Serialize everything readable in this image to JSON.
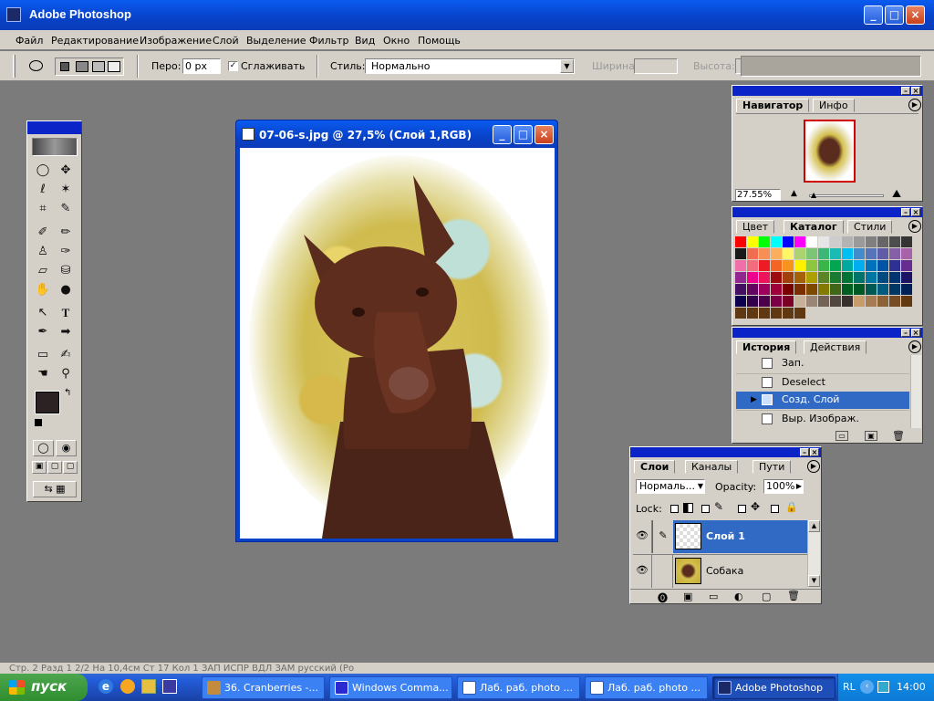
{
  "app": {
    "title": "Adobe Photoshop"
  },
  "menu": [
    "Файл",
    "Редактирование",
    "Изображение",
    "Слой",
    "Выделение",
    "Фильтр",
    "Вид",
    "Окно",
    "Помощь"
  ],
  "options": {
    "feather_label": "Перо:",
    "feather_value": "0 px",
    "antialias_label": "Сглаживать",
    "antialias_checked": true,
    "style_label": "Стиль:",
    "style_value": "Нормально",
    "width_label": "Ширина:",
    "height_label": "Высота:"
  },
  "document": {
    "title": "07-06-s.jpg @ 27,5% (Слой 1,RGB)"
  },
  "navigator": {
    "tabs": [
      "Навигатор",
      "Инфо"
    ],
    "zoom": "27.55%"
  },
  "swatches": {
    "tabs": [
      "Цвет",
      "Каталог",
      "Стили"
    ],
    "colors": [
      [
        "#ff0000",
        "#ffff00",
        "#00ff00",
        "#00ffff",
        "#0000ff",
        "#ff00ff",
        "#ffffff",
        "#e6e6e6",
        "#cdcdcd",
        "#b3b3b3",
        "#9a9a9a",
        "#808080",
        "#676767",
        "#4d4d4d",
        "#343434",
        "#1a1a1a"
      ],
      [
        "#f26c4f",
        "#f68e55",
        "#fbaf5d",
        "#fff568",
        "#acd372",
        "#7cc576",
        "#3bb878",
        "#1abbb4",
        "#00bff3",
        "#438ccb",
        "#5574b9",
        "#605ca8",
        "#855fa8",
        "#a763a8",
        "#f06ea9",
        "#f26d7d"
      ],
      [
        "#ed1c24",
        "#f26522",
        "#f7941d",
        "#fff200",
        "#8dc63f",
        "#39b54a",
        "#00a651",
        "#00a99d",
        "#00aeef",
        "#0072bc",
        "#0054a6",
        "#2e3192",
        "#662d91",
        "#92278f",
        "#ec008c",
        "#ed145b"
      ],
      [
        "#9e0b0f",
        "#a0410d",
        "#a36209",
        "#aba000",
        "#598527",
        "#197b30",
        "#007236",
        "#00746b",
        "#0076a3",
        "#004a80",
        "#003471",
        "#1b1464",
        "#440e62",
        "#630460",
        "#9e005d",
        "#9e0039"
      ],
      [
        "#790000",
        "#7b2e00",
        "#7d4900",
        "#827b00",
        "#406618",
        "#005e20",
        "#005826",
        "#005952",
        "#005b7f",
        "#003663",
        "#002157",
        "#0d004c",
        "#32004b",
        "#4b0049",
        "#7b0046",
        "#7a0026"
      ],
      [
        "#c7b299",
        "#998675",
        "#736357",
        "#534741",
        "#37302d",
        "#c69c6d",
        "#a67c52",
        "#8c6239",
        "#754c24",
        "#603913",
        "#603913",
        "#603913",
        "#603913",
        "#603913",
        "#603913",
        "#603913"
      ]
    ]
  },
  "history": {
    "tabs": [
      "История",
      "Действия"
    ],
    "items": [
      {
        "label": "Зап.",
        "selected": false
      },
      {
        "label": "Deselect",
        "selected": false
      },
      {
        "label": "Созд. Слой",
        "selected": true
      },
      {
        "label": "Выр. Изображ.",
        "selected": false
      }
    ]
  },
  "layers": {
    "tabs": [
      "Слои",
      "Каналы",
      "Пути"
    ],
    "blend_mode": "Нормаль...",
    "opacity_label": "Opacity:",
    "opacity_value": "100%",
    "lock_label": "Lock:",
    "items": [
      {
        "name": "Слой 1",
        "selected": true
      },
      {
        "name": "Собака",
        "selected": false
      }
    ]
  },
  "taskbar": {
    "start": "пуск",
    "items": [
      "36. Cranberries -...",
      "Windows Comma...",
      "Лаб. раб. photo ...",
      "Лаб. раб. photo ...",
      "Adobe Photoshop"
    ],
    "active_index": 4,
    "lang": "RL",
    "clock": "14:00"
  },
  "status_text": "Стр. 2     Разд 1     2/2     На 10,4см  Ст 17   Кол 1     ЗАП  ИСПР  ВДЛ  ЗАМ   русский (Ро"
}
